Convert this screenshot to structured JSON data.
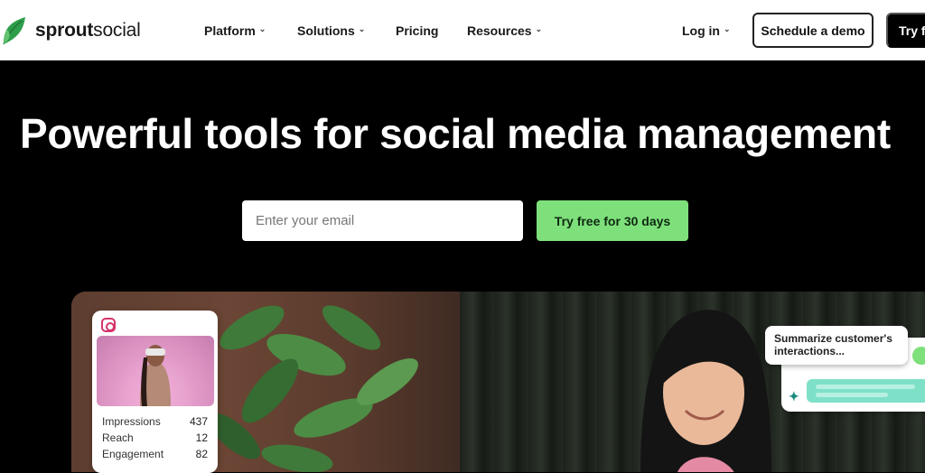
{
  "brand": {
    "name_bold": "sprout",
    "name_regular": "social",
    "accent_color": "#2e9e4a"
  },
  "nav": {
    "items": [
      {
        "label": "Platform",
        "has_dropdown": true
      },
      {
        "label": "Solutions",
        "has_dropdown": true
      },
      {
        "label": "Pricing",
        "has_dropdown": false
      },
      {
        "label": "Resources",
        "has_dropdown": true
      }
    ],
    "login": "Log in",
    "schedule_demo": "Schedule a demo",
    "try_free": "Try for free"
  },
  "hero": {
    "title": "Powerful tools for social media management",
    "email_placeholder": "Enter your email",
    "cta": "Try free for 30 days",
    "cta_color": "#7ee07b"
  },
  "instagram_card": {
    "icon": "instagram-icon",
    "stats": [
      {
        "label": "Impressions",
        "value": "437"
      },
      {
        "label": "Reach",
        "value": "12"
      },
      {
        "label": "Engagement",
        "value": "82"
      }
    ]
  },
  "ai_bubble": {
    "text": "Summarize customer's interactions..."
  },
  "chevron": "⌄"
}
